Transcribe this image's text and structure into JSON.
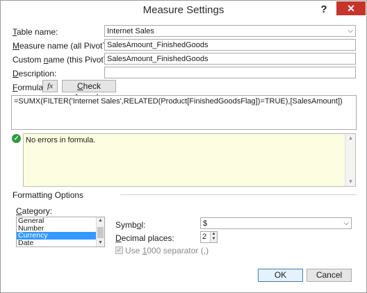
{
  "window": {
    "title": "Measure Settings",
    "help_glyph": "?",
    "close_glyph": "✕"
  },
  "table_name": {
    "label_u": "T",
    "label_rest": "able name:",
    "value": "Internet Sales"
  },
  "measure_name": {
    "label_u": "M",
    "label_rest": "easure name (all PivotTables):",
    "value": "SalesAmount_FinishedGoods"
  },
  "custom_name": {
    "label_pre": "Custom ",
    "label_u": "n",
    "label_rest": "ame (this PivotTable):",
    "value": "SalesAmount_FinishedGoods"
  },
  "description": {
    "label_u": "D",
    "label_rest": "escription:",
    "value": ""
  },
  "formula": {
    "label_u": "F",
    "label_rest": "ormula:",
    "fx_label": "fx",
    "check_u": "C",
    "check_rest": "heck formula",
    "text": "=SUMX(FILTER('Internet Sales',RELATED(Product[FinishedGoodsFlag])=TRUE),[SalesAmount])"
  },
  "status": {
    "message": "No errors in formula."
  },
  "formatting": {
    "heading": "Formatting Options",
    "category_label_u": "C",
    "category_label_rest": "ategory:",
    "categories": [
      "General",
      "Number",
      "Currency",
      "Date"
    ],
    "selected_category": "Currency",
    "symbol_label_pre": "Symb",
    "symbol_label_u": "o",
    "symbol_label_rest": "l:",
    "symbol_value": "$",
    "decimal_label_u": "D",
    "decimal_label_rest": "ecimal places:",
    "decimal_value": "2",
    "separator_label_pre": "Use ",
    "separator_label_u": "1",
    "separator_label_rest": "000 separator (,)",
    "separator_checked": true
  },
  "buttons": {
    "ok": "OK",
    "cancel": "Cancel"
  },
  "colors": {
    "close": "#c7352a",
    "selection": "#3399ff",
    "message_bg": "#fdfde2",
    "ok_border": "#3c7fb1"
  }
}
